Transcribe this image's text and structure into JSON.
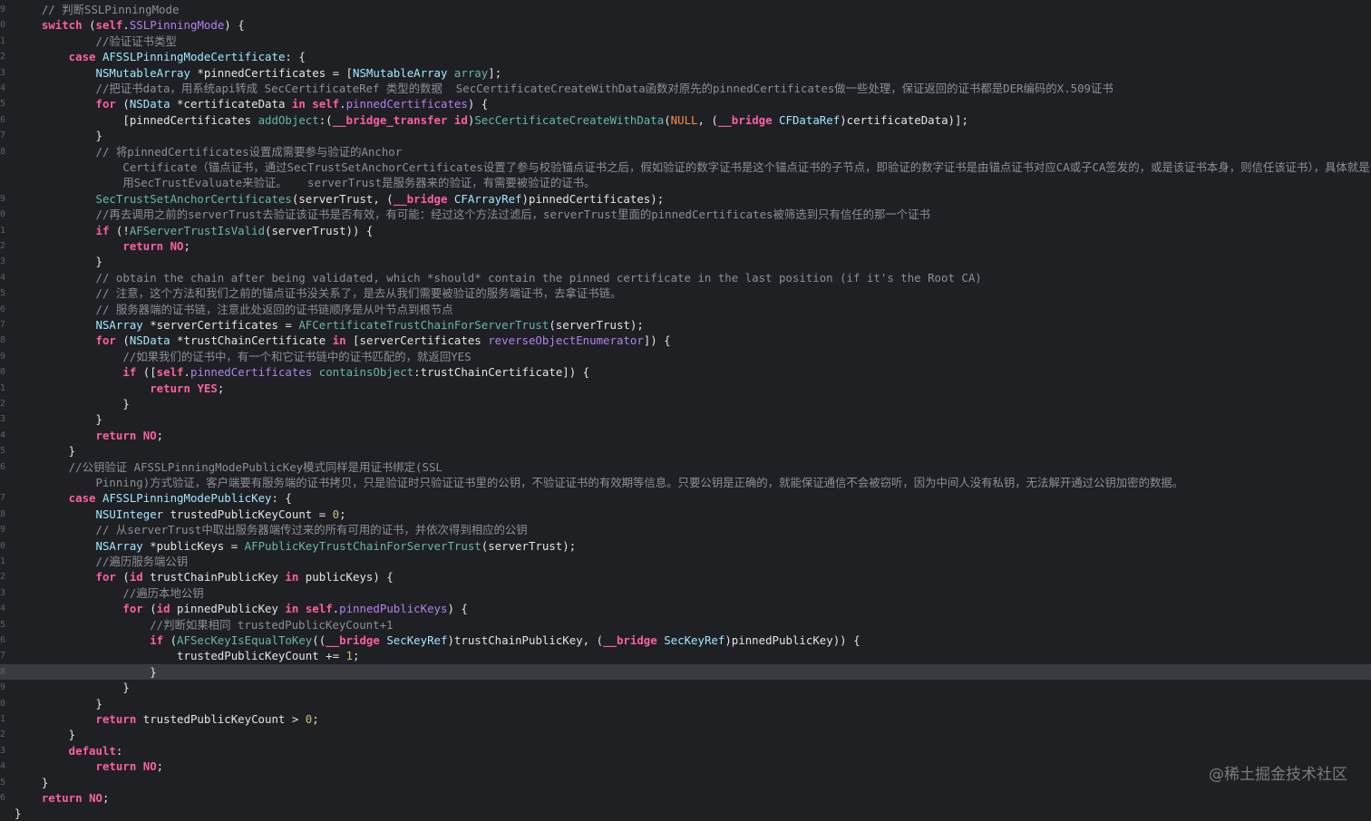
{
  "watermark": "@稀土掘金技术社区",
  "lines": [
    {
      "n": "9",
      "segs": [
        {
          "c": "cm",
          "t": "    // 判断SSLPinningMode"
        }
      ]
    },
    {
      "n": "0",
      "segs": [
        {
          "c": "kw",
          "t": "    switch"
        },
        {
          "c": "pl",
          "t": " ("
        },
        {
          "c": "kw",
          "t": "self"
        },
        {
          "c": "pl",
          "t": "."
        },
        {
          "c": "pr",
          "t": "SSLPinningMode"
        },
        {
          "c": "pl",
          "t": ") {"
        }
      ]
    },
    {
      "n": "1",
      "segs": [
        {
          "c": "cm",
          "t": "            //验证证书类型"
        }
      ]
    },
    {
      "n": "2",
      "segs": [
        {
          "c": "kw",
          "t": "        case"
        },
        {
          "c": "pl",
          "t": " "
        },
        {
          "c": "ty",
          "t": "AFSSLPinningModeCertificate"
        },
        {
          "c": "pl",
          "t": ": {"
        }
      ]
    },
    {
      "n": "3",
      "segs": [
        {
          "c": "ty",
          "t": "            NSMutableArray"
        },
        {
          "c": "pl",
          "t": " *pinnedCertificates = ["
        },
        {
          "c": "ty",
          "t": "NSMutableArray"
        },
        {
          "c": "pl",
          "t": " "
        },
        {
          "c": "fn",
          "t": "array"
        },
        {
          "c": "pl",
          "t": "];"
        }
      ]
    },
    {
      "n": "4",
      "segs": [
        {
          "c": "cm",
          "t": "            //把证书data，用系统api转成 SecCertificateRef 类型的数据  SecCertificateCreateWithData函数对原先的pinnedCertificates做一些处理，保证返回的证书都是DER编码的X.509证书"
        }
      ]
    },
    {
      "n": "5",
      "segs": [
        {
          "c": "kw",
          "t": "            for"
        },
        {
          "c": "pl",
          "t": " ("
        },
        {
          "c": "ty",
          "t": "NSData"
        },
        {
          "c": "pl",
          "t": " *certificateData "
        },
        {
          "c": "kw",
          "t": "in"
        },
        {
          "c": "pl",
          "t": " "
        },
        {
          "c": "kw",
          "t": "self"
        },
        {
          "c": "pl",
          "t": "."
        },
        {
          "c": "pr",
          "t": "pinnedCertificates"
        },
        {
          "c": "pl",
          "t": ") {"
        }
      ]
    },
    {
      "n": "6",
      "segs": [
        {
          "c": "pl",
          "t": "                [pinnedCertificates "
        },
        {
          "c": "fn",
          "t": "addObject"
        },
        {
          "c": "pl",
          "t": ":("
        },
        {
          "c": "kw",
          "t": "__bridge_transfer"
        },
        {
          "c": "pl",
          "t": " "
        },
        {
          "c": "kw",
          "t": "id"
        },
        {
          "c": "pl",
          "t": ")"
        },
        {
          "c": "fn",
          "t": "SecCertificateCreateWithData"
        },
        {
          "c": "pl",
          "t": "("
        },
        {
          "c": "mc",
          "t": "NULL"
        },
        {
          "c": "pl",
          "t": ", ("
        },
        {
          "c": "kw",
          "t": "__bridge"
        },
        {
          "c": "pl",
          "t": " "
        },
        {
          "c": "ty",
          "t": "CFDataRef"
        },
        {
          "c": "pl",
          "t": ")certificateData)];"
        }
      ]
    },
    {
      "n": "7",
      "segs": [
        {
          "c": "pl",
          "t": "            }"
        }
      ]
    },
    {
      "n": "8",
      "segs": [
        {
          "c": "cm",
          "t": "            // 将pinnedCertificates设置成需要参与验证的Anchor"
        }
      ]
    },
    {
      "n": "",
      "segs": [
        {
          "c": "cm",
          "t": "                Certificate（锚点证书，通过SecTrustSetAnchorCertificates设置了参与校验锚点证书之后，假如验证的数字证书是这个锚点证书的子节点，即验证的数字证书是由锚点证书对应CA或子CA签发的，或是该证书本身，则信任该证书），具体就是调"
        }
      ]
    },
    {
      "n": "",
      "segs": [
        {
          "c": "cm",
          "t": "                用SecTrustEvaluate来验证。   serverTrust是服务器来的验证，有需要被验证的证书。"
        }
      ]
    },
    {
      "n": "9",
      "segs": [
        {
          "c": "fn",
          "t": "            SecTrustSetAnchorCertificates"
        },
        {
          "c": "pl",
          "t": "(serverTrust, ("
        },
        {
          "c": "kw",
          "t": "__bridge"
        },
        {
          "c": "pl",
          "t": " "
        },
        {
          "c": "ty",
          "t": "CFArrayRef"
        },
        {
          "c": "pl",
          "t": ")pinnedCertificates);"
        }
      ]
    },
    {
      "n": "0",
      "segs": [
        {
          "c": "cm",
          "t": "            //再去调用之前的serverTrust去验证该证书是否有效，有可能：经过这个方法过滤后，serverTrust里面的pinnedCertificates被筛选到只有信任的那一个证书"
        }
      ]
    },
    {
      "n": "1",
      "segs": [
        {
          "c": "kw",
          "t": "            if"
        },
        {
          "c": "pl",
          "t": " (!"
        },
        {
          "c": "fn",
          "t": "AFServerTrustIsValid"
        },
        {
          "c": "pl",
          "t": "(serverTrust)) {"
        }
      ]
    },
    {
      "n": "2",
      "segs": [
        {
          "c": "kw",
          "t": "                return"
        },
        {
          "c": "pl",
          "t": " "
        },
        {
          "c": "kw",
          "t": "NO"
        },
        {
          "c": "pl",
          "t": ";"
        }
      ]
    },
    {
      "n": "3",
      "segs": [
        {
          "c": "pl",
          "t": "            }"
        }
      ]
    },
    {
      "n": "4",
      "segs": [
        {
          "c": "cm",
          "t": "            // obtain the chain after being validated, which *should* contain the pinned certificate in the last position (if it's the Root CA)"
        }
      ]
    },
    {
      "n": "5",
      "segs": [
        {
          "c": "cm",
          "t": "            // 注意，这个方法和我们之前的锚点证书没关系了，是去从我们需要被验证的服务端证书，去拿证书链。"
        }
      ]
    },
    {
      "n": "6",
      "segs": [
        {
          "c": "cm",
          "t": "            // 服务器端的证书链，注意此处返回的证书链顺序是从叶节点到根节点"
        }
      ]
    },
    {
      "n": "7",
      "segs": [
        {
          "c": "ty",
          "t": "            NSArray"
        },
        {
          "c": "pl",
          "t": " *serverCertificates = "
        },
        {
          "c": "fn",
          "t": "AFCertificateTrustChainForServerTrust"
        },
        {
          "c": "pl",
          "t": "(serverTrust);"
        }
      ]
    },
    {
      "n": "8",
      "segs": [
        {
          "c": "kw",
          "t": "            for"
        },
        {
          "c": "pl",
          "t": " ("
        },
        {
          "c": "ty",
          "t": "NSData"
        },
        {
          "c": "pl",
          "t": " *trustChainCertificate "
        },
        {
          "c": "kw",
          "t": "in"
        },
        {
          "c": "pl",
          "t": " [serverCertificates "
        },
        {
          "c": "pr",
          "t": "reverseObjectEnumerator"
        },
        {
          "c": "pl",
          "t": "]) {"
        }
      ]
    },
    {
      "n": "9",
      "segs": [
        {
          "c": "cm",
          "t": "                //如果我们的证书中，有一个和它证书链中的证书匹配的，就返回YES"
        }
      ]
    },
    {
      "n": "0",
      "segs": [
        {
          "c": "kw",
          "t": "                if"
        },
        {
          "c": "pl",
          "t": " (["
        },
        {
          "c": "kw",
          "t": "self"
        },
        {
          "c": "pl",
          "t": "."
        },
        {
          "c": "pr",
          "t": "pinnedCertificates"
        },
        {
          "c": "pl",
          "t": " "
        },
        {
          "c": "fn",
          "t": "containsObject"
        },
        {
          "c": "pl",
          "t": ":trustChainCertificate]) {"
        }
      ]
    },
    {
      "n": "1",
      "segs": [
        {
          "c": "kw",
          "t": "                    return"
        },
        {
          "c": "pl",
          "t": " "
        },
        {
          "c": "kw",
          "t": "YES"
        },
        {
          "c": "pl",
          "t": ";"
        }
      ]
    },
    {
      "n": "2",
      "segs": [
        {
          "c": "pl",
          "t": "                }"
        }
      ]
    },
    {
      "n": "3",
      "segs": [
        {
          "c": "pl",
          "t": "            }"
        }
      ]
    },
    {
      "n": "4",
      "segs": [
        {
          "c": "kw",
          "t": "            return"
        },
        {
          "c": "pl",
          "t": " "
        },
        {
          "c": "kw",
          "t": "NO"
        },
        {
          "c": "pl",
          "t": ";"
        }
      ]
    },
    {
      "n": "5",
      "segs": [
        {
          "c": "pl",
          "t": "        }"
        }
      ]
    },
    {
      "n": "6",
      "segs": [
        {
          "c": "cm",
          "t": "        //公钥验证 AFSSLPinningModePublicKey模式同样是用证书绑定(SSL"
        }
      ]
    },
    {
      "n": "",
      "segs": [
        {
          "c": "cm",
          "t": "            Pinning)方式验证，客户端要有服务端的证书拷贝，只是验证时只验证证书里的公钥，不验证证书的有效期等信息。只要公钥是正确的，就能保证通信不会被窃听，因为中间人没有私钥，无法解开通过公钥加密的数据。"
        }
      ]
    },
    {
      "n": "7",
      "segs": [
        {
          "c": "kw",
          "t": "        case"
        },
        {
          "c": "pl",
          "t": " "
        },
        {
          "c": "ty",
          "t": "AFSSLPinningModePublicKey"
        },
        {
          "c": "pl",
          "t": ": {"
        }
      ]
    },
    {
      "n": "8",
      "segs": [
        {
          "c": "ty",
          "t": "            NSUInteger"
        },
        {
          "c": "pl",
          "t": " trustedPublicKeyCount = "
        },
        {
          "c": "num",
          "t": "0"
        },
        {
          "c": "pl",
          "t": ";"
        }
      ]
    },
    {
      "n": "9",
      "segs": [
        {
          "c": "cm",
          "t": "            // 从serverTrust中取出服务器端传过来的所有可用的证书，并依次得到相应的公钥"
        }
      ]
    },
    {
      "n": "0",
      "segs": [
        {
          "c": "ty",
          "t": "            NSArray"
        },
        {
          "c": "pl",
          "t": " *publicKeys = "
        },
        {
          "c": "fn",
          "t": "AFPublicKeyTrustChainForServerTrust"
        },
        {
          "c": "pl",
          "t": "(serverTrust);"
        }
      ]
    },
    {
      "n": "1",
      "segs": [
        {
          "c": "cm",
          "t": "            //遍历服务端公钥"
        }
      ]
    },
    {
      "n": "2",
      "segs": [
        {
          "c": "kw",
          "t": "            for"
        },
        {
          "c": "pl",
          "t": " ("
        },
        {
          "c": "kw",
          "t": "id"
        },
        {
          "c": "pl",
          "t": " trustChainPublicKey "
        },
        {
          "c": "kw",
          "t": "in"
        },
        {
          "c": "pl",
          "t": " publicKeys) {"
        }
      ]
    },
    {
      "n": "3",
      "segs": [
        {
          "c": "cm",
          "t": "                //遍历本地公钥"
        }
      ]
    },
    {
      "n": "4",
      "segs": [
        {
          "c": "kw",
          "t": "                for"
        },
        {
          "c": "pl",
          "t": " ("
        },
        {
          "c": "kw",
          "t": "id"
        },
        {
          "c": "pl",
          "t": " pinnedPublicKey "
        },
        {
          "c": "kw",
          "t": "in"
        },
        {
          "c": "pl",
          "t": " "
        },
        {
          "c": "kw",
          "t": "self"
        },
        {
          "c": "pl",
          "t": "."
        },
        {
          "c": "pr",
          "t": "pinnedPublicKeys"
        },
        {
          "c": "pl",
          "t": ") {"
        }
      ]
    },
    {
      "n": "5",
      "segs": [
        {
          "c": "cm",
          "t": "                    //判断如果相同 trustedPublicKeyCount+1"
        }
      ]
    },
    {
      "n": "6",
      "segs": [
        {
          "c": "kw",
          "t": "                    if"
        },
        {
          "c": "pl",
          "t": " ("
        },
        {
          "c": "fn",
          "t": "AFSecKeyIsEqualToKey"
        },
        {
          "c": "pl",
          "t": "(("
        },
        {
          "c": "kw",
          "t": "__bridge"
        },
        {
          "c": "pl",
          "t": " "
        },
        {
          "c": "ty",
          "t": "SecKeyRef"
        },
        {
          "c": "pl",
          "t": ")trustChainPublicKey, ("
        },
        {
          "c": "kw",
          "t": "__bridge"
        },
        {
          "c": "pl",
          "t": " "
        },
        {
          "c": "ty",
          "t": "SecKeyRef"
        },
        {
          "c": "pl",
          "t": ")pinnedPublicKey)) {"
        }
      ]
    },
    {
      "n": "7",
      "segs": [
        {
          "c": "pl",
          "t": "                        trustedPublicKeyCount += "
        },
        {
          "c": "num",
          "t": "1"
        },
        {
          "c": "pl",
          "t": ";"
        }
      ]
    },
    {
      "n": "8",
      "hl": true,
      "segs": [
        {
          "c": "pl",
          "t": "                    }"
        }
      ]
    },
    {
      "n": "9",
      "segs": [
        {
          "c": "pl",
          "t": "                }"
        }
      ]
    },
    {
      "n": "0",
      "segs": [
        {
          "c": "pl",
          "t": "            }"
        }
      ]
    },
    {
      "n": "1",
      "segs": [
        {
          "c": "kw",
          "t": "            return"
        },
        {
          "c": "pl",
          "t": " trustedPublicKeyCount > "
        },
        {
          "c": "num",
          "t": "0"
        },
        {
          "c": "pl",
          "t": ";"
        }
      ]
    },
    {
      "n": "2",
      "segs": [
        {
          "c": "pl",
          "t": "        }"
        }
      ]
    },
    {
      "n": "3",
      "segs": [
        {
          "c": "kw",
          "t": "        default"
        },
        {
          "c": "pl",
          "t": ":"
        }
      ]
    },
    {
      "n": "4",
      "segs": [
        {
          "c": "kw",
          "t": "            return"
        },
        {
          "c": "pl",
          "t": " "
        },
        {
          "c": "kw",
          "t": "NO"
        },
        {
          "c": "pl",
          "t": ";"
        }
      ]
    },
    {
      "n": "5",
      "segs": [
        {
          "c": "pl",
          "t": "    }"
        }
      ]
    },
    {
      "n": "6",
      "segs": [
        {
          "c": "kw",
          "t": "    return"
        },
        {
          "c": "pl",
          "t": " "
        },
        {
          "c": "kw",
          "t": "NO"
        },
        {
          "c": "pl",
          "t": ";"
        }
      ]
    },
    {
      "n": "",
      "segs": [
        {
          "c": "pl",
          "t": "}"
        }
      ]
    }
  ]
}
